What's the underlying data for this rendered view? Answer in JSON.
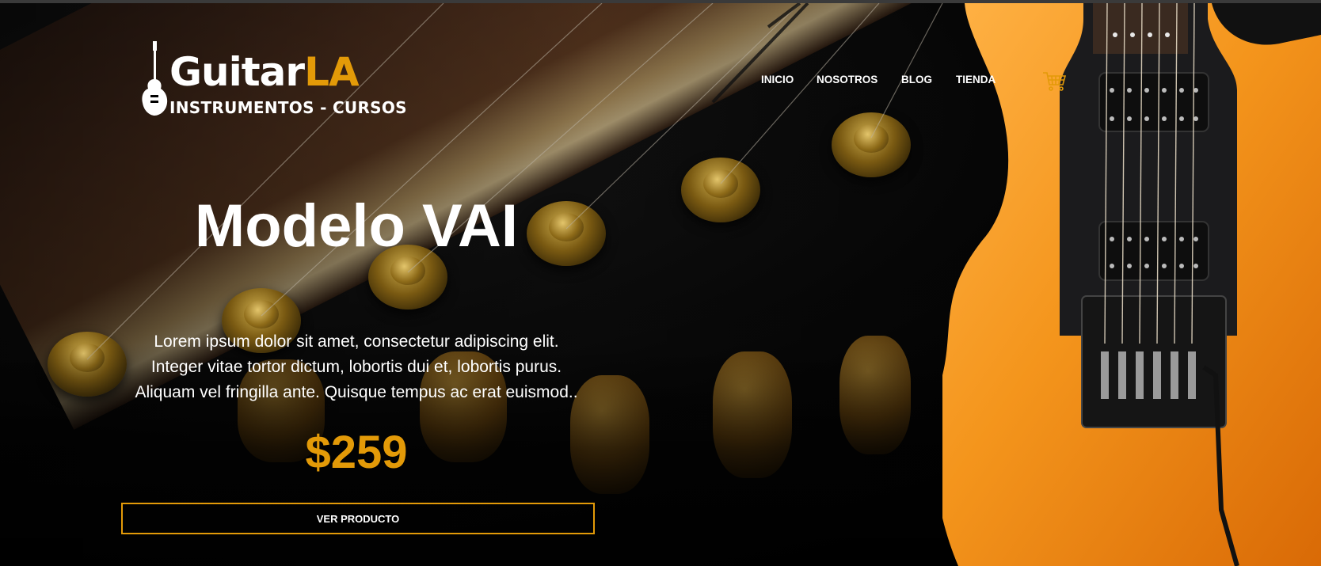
{
  "header": {
    "logo": {
      "word_primary": "Guitar",
      "word_accent": "LA",
      "tagline": "INSTRUMENTOS - CURSOS"
    },
    "nav": [
      {
        "label": "INICIO"
      },
      {
        "label": "NOSOTROS"
      },
      {
        "label": "BLOG"
      },
      {
        "label": "TIENDA"
      }
    ],
    "cart_icon": "shopping-cart-icon"
  },
  "hero": {
    "title": "Modelo VAI",
    "description": [
      "Lorem ipsum dolor sit amet, consectetur adipiscing elit.",
      "Integer vitae tortor dictum, lobortis dui et, lobortis purus.",
      "Aliquam vel fringilla ante. Quisque tempus ac erat euismod.."
    ],
    "price": "$259",
    "button_label": "VER PRODUCTO"
  },
  "colors": {
    "accent": "#e39a08",
    "background": "#000000",
    "guitar_body": "#f28c12",
    "text": "#ffffff"
  }
}
